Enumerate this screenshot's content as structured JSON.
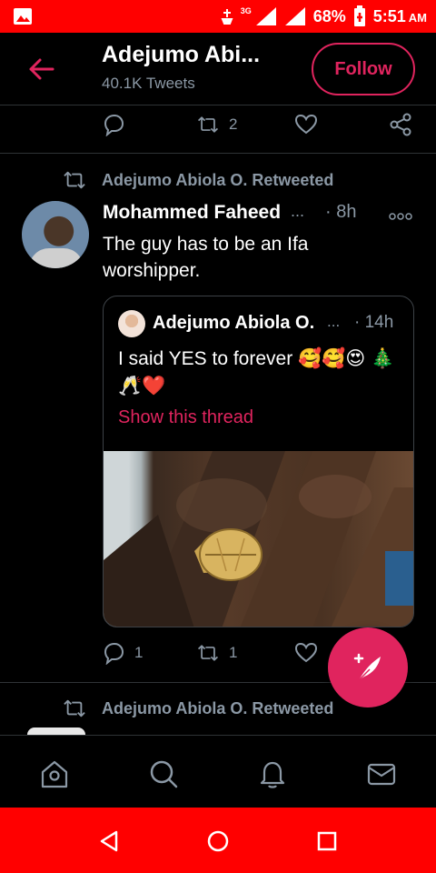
{
  "status_bar": {
    "network": "3G",
    "battery": "68%",
    "time": "5:51",
    "time_suffix": "AM"
  },
  "header": {
    "title": "Adejumo Abi...",
    "subtitle": "40.1K Tweets",
    "follow_label": "Follow"
  },
  "top_actions": {
    "retweet_count": "2"
  },
  "tweet": {
    "retweeted_by": "Adejumo Abiola O. Retweeted",
    "author": "Mohammed Faheed",
    "author_ellipsis": "...",
    "time": "· 8h",
    "more": "ooo",
    "text": "The guy has to be an Ifa worshipper.",
    "quote": {
      "author": "Adejumo Abiola O.",
      "author_ellipsis": "...",
      "time": "· 14h",
      "text": "I said YES to forever 🥰🥰😍 🎄🥂❤️",
      "show_thread": "Show this thread"
    },
    "reply_count": "1",
    "retweet_count": "1"
  },
  "next_tweet": {
    "retweeted_by": "Adejumo Abiola O. Retweeted"
  },
  "colors": {
    "accent": "#e0245e",
    "muted": "#8b98a5",
    "system_bar": "#ff0000"
  },
  "icons": {
    "tabs": [
      "home-icon",
      "search-icon",
      "notifications-icon",
      "messages-icon"
    ],
    "nav": [
      "back-triangle-icon",
      "home-circle-icon",
      "recents-square-icon"
    ]
  }
}
